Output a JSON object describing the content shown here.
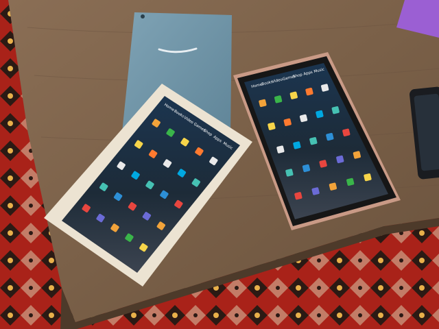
{
  "colors": {
    "table": "#7a6048",
    "table_dark": "#5b4634",
    "rug_red": "#b3261e",
    "rug_dark": "#2b1a14",
    "tablet_white_frame": "#ece3d2",
    "tablet_blue_back": "#6f93a6",
    "tablet_rose_frame": "#c99a86",
    "screen_dark": "#0f1a26",
    "accent_purple": "#9b5fd3"
  },
  "tablets": {
    "left": {
      "nav": [
        "Home",
        "Books",
        "Video",
        "Games",
        "Shop",
        "Apps",
        "Music"
      ],
      "app_rows": 5,
      "app_cols": 5
    },
    "right": {
      "nav": [
        "Home",
        "Books",
        "Video",
        "Games",
        "Shop",
        "Apps",
        "Music"
      ],
      "app_rows": 5,
      "app_cols": 5
    }
  },
  "app_icon_colors": [
    "#f2a33a",
    "#2d8fd6",
    "#e9e9e9",
    "#3ab54a",
    "#e8463f",
    "#00a8e1",
    "#f7d54a",
    "#6b6bd6",
    "#46c1b3",
    "#ff7a2f"
  ]
}
